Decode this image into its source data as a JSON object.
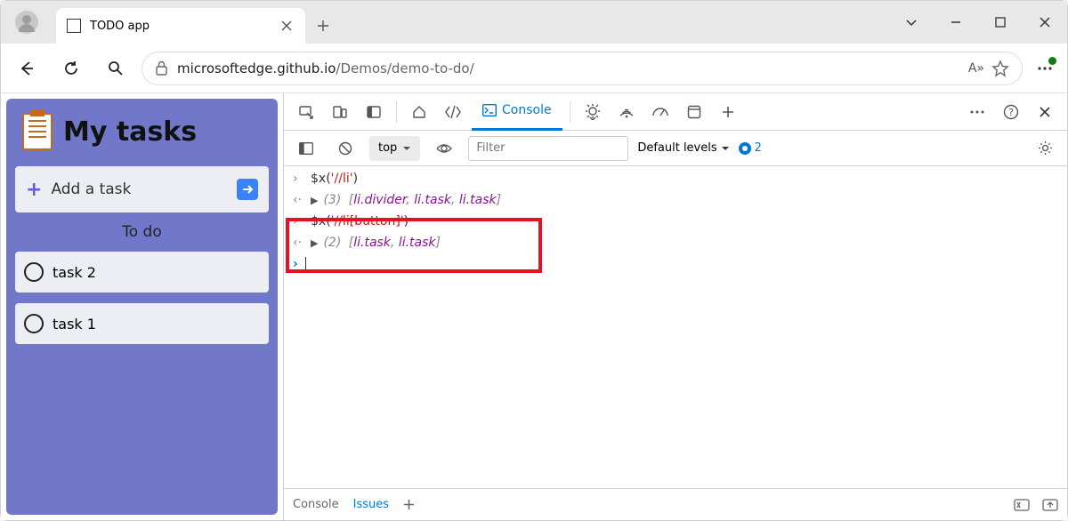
{
  "window": {
    "tab_title": "TODO app"
  },
  "address_bar": {
    "url_gray_prefix": "microsoftedge.github.io",
    "url_path": "/Demos/demo-to-do/",
    "read_aloud_label": "A»"
  },
  "app": {
    "title": "My tasks",
    "add_task_label": "Add a task",
    "section_label": "To do",
    "tasks": [
      "task 2",
      "task 1"
    ]
  },
  "devtools": {
    "console_tab_label": "Console",
    "context_selector": "top",
    "filter_placeholder": "Filter",
    "levels_label": "Default levels",
    "issues_count": "2",
    "status_console": "Console",
    "status_issues": "Issues"
  },
  "console_log": {
    "line1_code": "$x(",
    "line1_str": "'//li'",
    "line1_close": ")",
    "line2_count": "(3)",
    "line2_item1": "li.divider",
    "line2_item2": "li.task",
    "line2_item3": "li.task",
    "line3_code": "$x(",
    "line3_str": "'//li[button]'",
    "line3_close": ")",
    "line4_count": "(2)",
    "line4_item1": "li.task",
    "line4_item2": "li.task"
  }
}
